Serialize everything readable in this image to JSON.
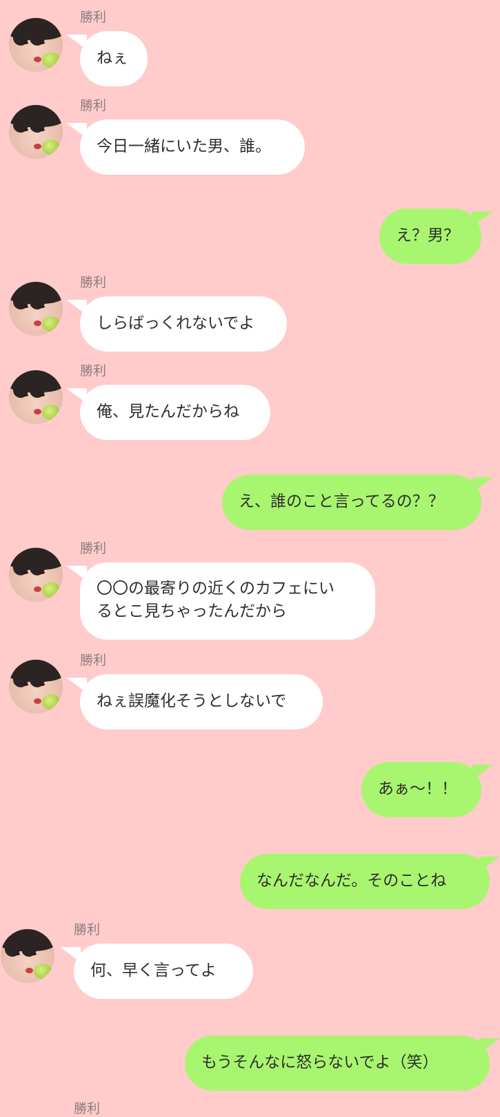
{
  "chat": {
    "partner_name": "勝利",
    "messages": [
      {
        "side": "left",
        "sender": "勝利",
        "lines": [
          "ねぇ"
        ]
      },
      {
        "side": "left",
        "sender": "勝利",
        "lines": [
          "今日一緒にいた男、誰。"
        ]
      },
      {
        "side": "right",
        "lines": [
          "え？男？"
        ]
      },
      {
        "side": "left",
        "sender": "勝利",
        "lines": [
          "しらばっくれないでよ"
        ]
      },
      {
        "side": "left",
        "sender": "勝利",
        "lines": [
          "俺、見たんだからね"
        ]
      },
      {
        "side": "right",
        "lines": [
          "え、誰のこと言ってるの？？"
        ]
      },
      {
        "side": "left",
        "sender": "勝利",
        "lines": [
          "〇〇の最寄りの近くのカフェにい",
          "るとこ見ちゃったんだから"
        ]
      },
      {
        "side": "left",
        "sender": "勝利",
        "lines": [
          "ねぇ誤魔化そうとしないで"
        ]
      },
      {
        "side": "right",
        "lines": [
          "あぁ〜！！"
        ]
      },
      {
        "side": "right",
        "lines": [
          "なんだなんだ。そのことね"
        ]
      },
      {
        "side": "left",
        "sender": "勝利",
        "lines": [
          "何、早く言ってよ"
        ]
      },
      {
        "side": "right",
        "lines": [
          "もうそんなに怒らないでよ（笑）"
        ]
      },
      {
        "side": "left",
        "sender": "勝利",
        "lines": []
      }
    ]
  }
}
